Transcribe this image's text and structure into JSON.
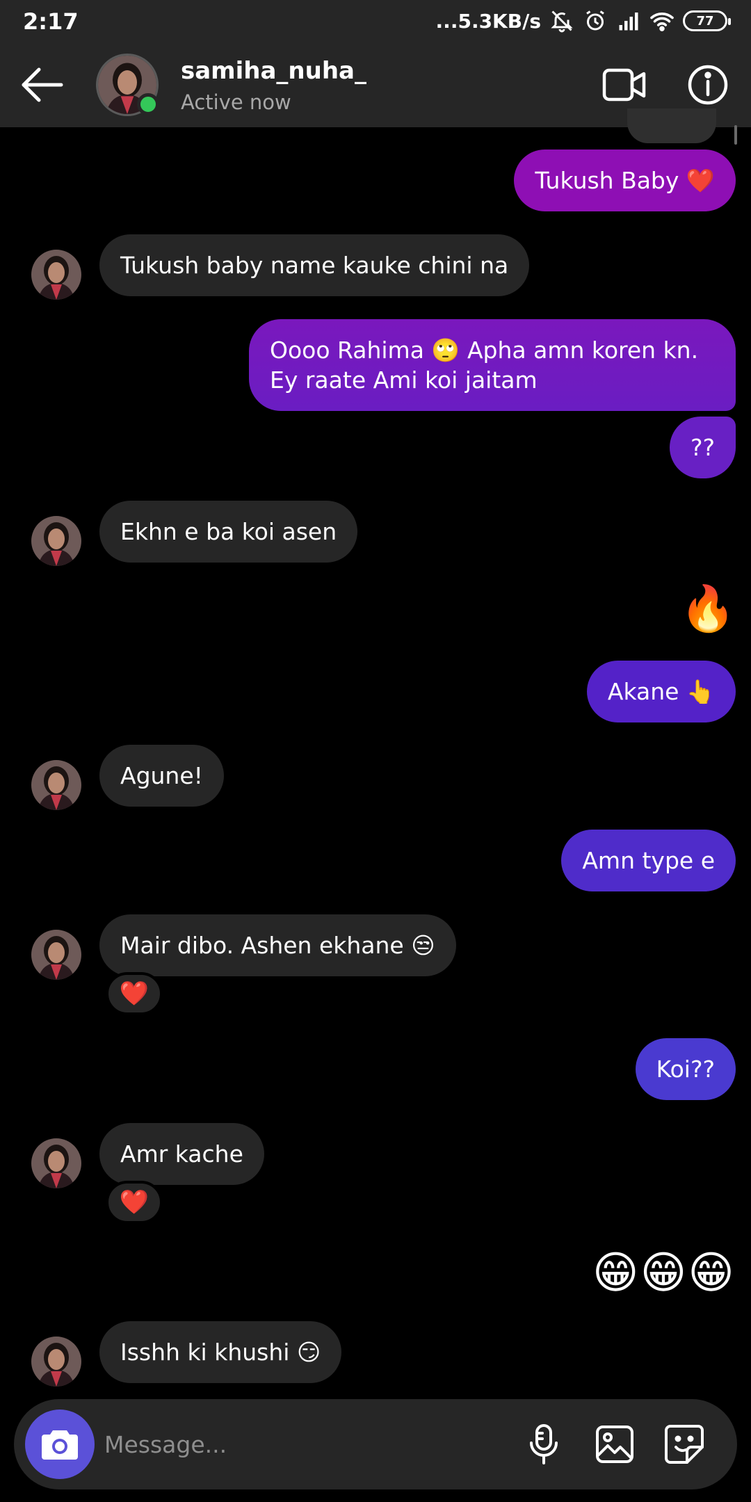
{
  "status_bar": {
    "time": "2:17",
    "network_speed": "...5.3KB/s",
    "battery": "77",
    "icons": [
      "bell-muted-icon",
      "alarm-icon",
      "signal-icon",
      "wifi-icon",
      "battery-icon"
    ]
  },
  "header": {
    "username": "samiha_nuha_",
    "status": "Active now",
    "online_color": "#34c759"
  },
  "messages": [
    {
      "from": "me",
      "text": "Tukush Baby ❤️"
    },
    {
      "from": "them",
      "text": "Tukush baby name kauke chini na"
    },
    {
      "from": "me",
      "text": "Oooo Rahima 🙄 Apha amn koren kn. Ey raate Ami koi jaitam"
    },
    {
      "from": "me",
      "text": "??"
    },
    {
      "from": "them",
      "text": "Ekhn e ba koi asen"
    },
    {
      "from": "me",
      "text": "🔥"
    },
    {
      "from": "me",
      "text": "Akane 👆"
    },
    {
      "from": "them",
      "text": "Agune!"
    },
    {
      "from": "me",
      "text": "Amn type e"
    },
    {
      "from": "them",
      "text": "Mair dibo. Ashen ekhane 😒",
      "reaction": "❤️"
    },
    {
      "from": "me",
      "text": "Koi??"
    },
    {
      "from": "them",
      "text": "Amr kache",
      "reaction": "❤️"
    },
    {
      "from": "me",
      "text": "😁😁😁"
    },
    {
      "from": "them",
      "text": "Isshh ki khushi 😏"
    }
  ],
  "composer": {
    "placeholder": "Message...",
    "icons": [
      "camera-icon",
      "microphone-icon",
      "gallery-icon",
      "sticker-icon"
    ]
  },
  "colors": {
    "background": "#000000",
    "received_bubble": "#262626",
    "sent_gradient_top": "#8e0fb4",
    "sent_gradient_mid": "#5a22c8",
    "sent_gradient_bottom": "#4a3ad0",
    "accent": "#5b51d8"
  }
}
